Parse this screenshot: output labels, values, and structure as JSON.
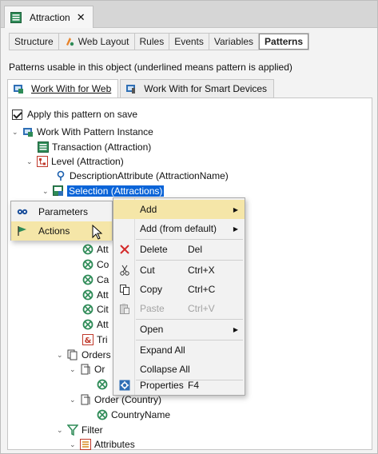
{
  "document_tab": {
    "title": "Attraction",
    "close": "✕"
  },
  "subtabs": [
    {
      "label": "Structure",
      "active": false
    },
    {
      "label": "Web Layout",
      "active": false
    },
    {
      "label": "Rules",
      "active": false
    },
    {
      "label": "Events",
      "active": false
    },
    {
      "label": "Variables",
      "active": false
    },
    {
      "label": "Patterns",
      "active": true
    }
  ],
  "patterns_note": "Patterns usable in this object (underlined means pattern is applied)",
  "pattern_tabs": [
    {
      "label": "Work With for Web",
      "active": true
    },
    {
      "label": "Work With for Smart Devices",
      "active": false
    }
  ],
  "apply_checkbox": {
    "label": "Apply this pattern on save",
    "checked": true
  },
  "tree": {
    "root": "Work With Pattern Instance",
    "transaction": "Transaction (Attraction)",
    "level": "Level (Attraction)",
    "description_attribute": "DescriptionAttribute (AttractionName)",
    "selection": "Selection (Attractions)",
    "attr_partials": [
      "Att",
      "Co",
      "Ca",
      "Att",
      "Cit",
      "Att"
    ],
    "tri_partial": "Tri",
    "orders_partial": "Orders",
    "order_partial": "Or",
    "order_country": "Order (Country)",
    "country_name": "CountryName",
    "filter": "Filter",
    "attributes": "Attributes"
  },
  "left_menu": {
    "items": [
      {
        "label": "Parameters",
        "icon": "parameters-icon"
      },
      {
        "label": "Actions",
        "icon": "actions-flag-icon"
      }
    ]
  },
  "context_menu": {
    "items": [
      {
        "label": "Add",
        "shortcut": "",
        "submenu": true,
        "icon": "",
        "highlight": true,
        "disabled": false
      },
      {
        "label": "Add (from default)",
        "shortcut": "",
        "submenu": true,
        "icon": "",
        "highlight": false,
        "disabled": false
      },
      {
        "label": "Delete",
        "shortcut": "Del",
        "submenu": false,
        "icon": "delete-icon",
        "highlight": false,
        "disabled": false
      },
      {
        "label": "Cut",
        "shortcut": "Ctrl+X",
        "submenu": false,
        "icon": "cut-icon",
        "highlight": false,
        "disabled": false
      },
      {
        "label": "Copy",
        "shortcut": "Ctrl+C",
        "submenu": false,
        "icon": "copy-icon",
        "highlight": false,
        "disabled": false
      },
      {
        "label": "Paste",
        "shortcut": "Ctrl+V",
        "submenu": false,
        "icon": "paste-icon",
        "highlight": false,
        "disabled": true
      },
      {
        "label": "Open",
        "shortcut": "",
        "submenu": true,
        "icon": "",
        "highlight": false,
        "disabled": false
      },
      {
        "label": "Expand All",
        "shortcut": "",
        "submenu": false,
        "icon": "",
        "highlight": false,
        "disabled": false
      },
      {
        "label": "Collapse All",
        "shortcut": "",
        "submenu": false,
        "icon": "",
        "highlight": false,
        "disabled": false
      },
      {
        "label": "Properties",
        "shortcut": "F4",
        "submenu": false,
        "icon": "properties-icon",
        "highlight": false,
        "disabled": false
      }
    ]
  },
  "colors": {
    "selection": "#0a64d8",
    "menu_highlight": "#f5e6a8",
    "delete_red": "#d42a2a"
  }
}
